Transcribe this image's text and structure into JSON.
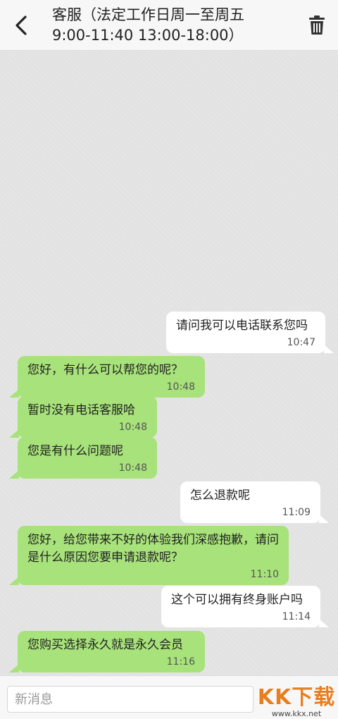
{
  "header": {
    "title": "客服（法定工作日周一至周五\n9:00-11:40 13:00-18:00）"
  },
  "messages": [
    {
      "side": "sent",
      "text": "请问我可以电话联系您吗",
      "time": "10:47"
    },
    {
      "side": "recv",
      "text": "您好，有什么可以帮您的呢？",
      "time": "10:48"
    },
    {
      "side": "recv",
      "text": "暂时没有电话客服哈",
      "time": "10:48"
    },
    {
      "side": "recv",
      "text": "您是有什么问题呢",
      "time": "10:48"
    },
    {
      "side": "sent",
      "text": "怎么退款呢",
      "time": "11:09"
    },
    {
      "side": "recv",
      "text": "您好，给您带来不好的体验我们深感抱歉，请问是什么原因您要申请退款呢？",
      "time": "11:10"
    },
    {
      "side": "sent",
      "text": "这个可以拥有终身账户吗",
      "time": "11:14"
    },
    {
      "side": "recv",
      "text": "您购买选择永久就是永久会员",
      "time": "11:16"
    }
  ],
  "composer": {
    "placeholder": "新消息"
  },
  "watermark": {
    "main": "KK下载",
    "sub": "www.kkx.net"
  },
  "colors": {
    "received_bubble": "#a7e27a",
    "sent_bubble": "#ffffff",
    "header_bg": "#f7f7f7",
    "chat_bg": "#e4e4e4",
    "watermark": "#e67e22"
  },
  "icons": {
    "back": "chevron-left-icon",
    "delete": "trash-icon"
  }
}
